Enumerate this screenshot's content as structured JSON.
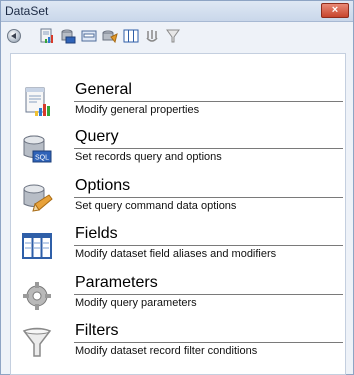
{
  "window": {
    "title": "DataSet",
    "close_label": "×"
  },
  "toolbar": {
    "icons": [
      "back-icon",
      "general-icon",
      "query-icon",
      "options-icon",
      "fields-icon",
      "parameters-icon",
      "filters-icon"
    ]
  },
  "items": [
    {
      "label": "General",
      "description": "Modify general properties",
      "icon": "general-icon"
    },
    {
      "label": "Query",
      "description": "Set records query and options",
      "icon": "query-icon"
    },
    {
      "label": "Options",
      "description": "Set query command data options",
      "icon": "options-icon"
    },
    {
      "label": "Fields",
      "description": "Modify dataset field aliases and modifiers",
      "icon": "fields-icon"
    },
    {
      "label": "Parameters",
      "description": "Modify query parameters",
      "icon": "parameters-icon"
    },
    {
      "label": "Filters",
      "description": "Modify dataset record filter conditions",
      "icon": "filters-icon"
    }
  ]
}
